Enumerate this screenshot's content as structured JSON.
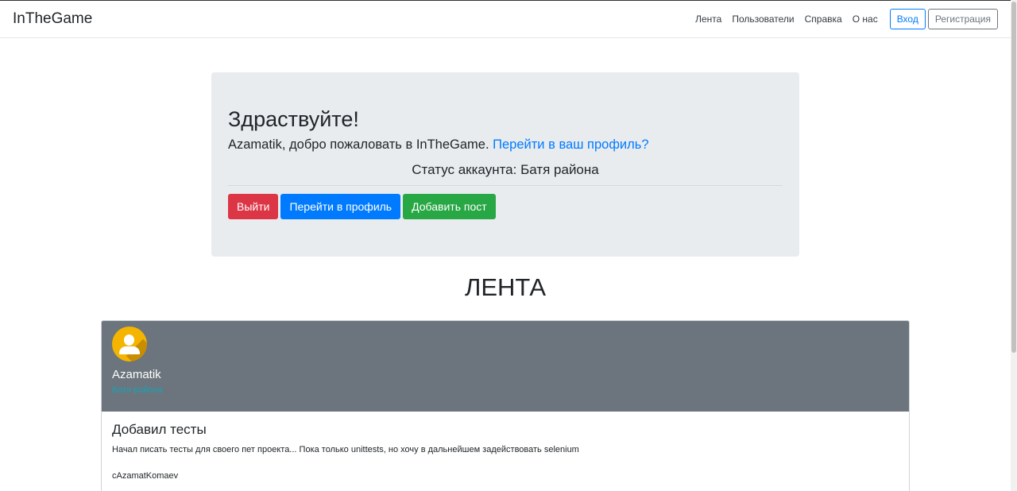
{
  "navbar": {
    "brand": "InTheGame",
    "links": [
      "Лента",
      "Пользователи",
      "Справка",
      "О нас"
    ],
    "login_label": "Вход",
    "register_label": "Регистрация"
  },
  "welcome": {
    "heading": "Здраствуйте!",
    "greeting": "Azamatik, добро пожаловать в InTheGame.",
    "profile_link": "Перейти в ваш профиль?",
    "status": "Статус аккаунта: Батя района",
    "buttons": {
      "logout": "Выйти",
      "profile": "Перейти в профиль",
      "add_post": "Добавить пост"
    }
  },
  "feed": {
    "title": "ЛЕНТА",
    "posts": [
      {
        "author": "Azamatik",
        "author_status": "Батя района",
        "title": "Добавил тесты",
        "text": "Начал писать тесты для своего пет проекта... Пока только unittests, но хочу в дальнейшем задействовать selenium",
        "signature": "cAzamatKomaev"
      }
    ]
  },
  "colors": {
    "primary": "#007bff",
    "danger": "#dc3545",
    "success": "#28a745",
    "card_header": "#6c757d",
    "jumbotron": "#e9ecef",
    "status_text": "#17a2b8",
    "avatar": "#f5b400"
  },
  "icons": {
    "avatar": "user-avatar-icon"
  }
}
